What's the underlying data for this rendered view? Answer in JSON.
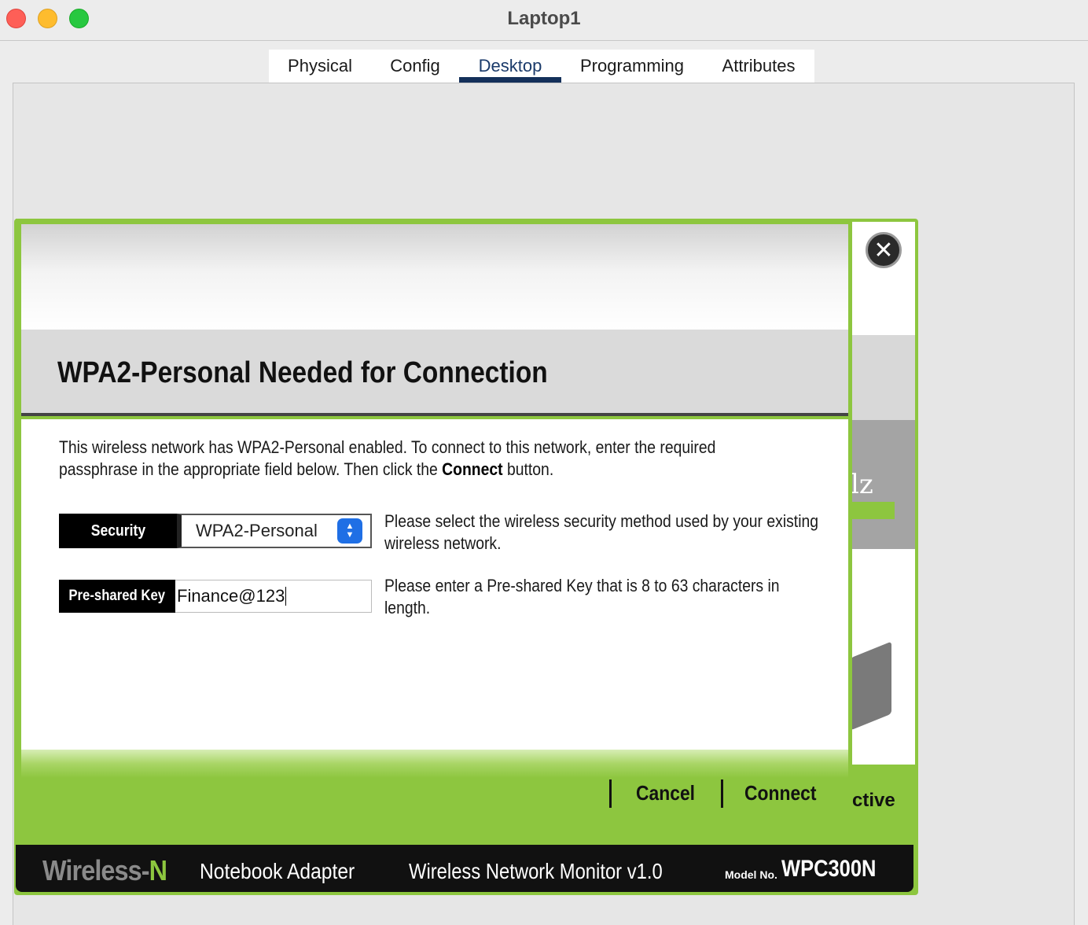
{
  "window": {
    "title": "Laptop1"
  },
  "tabs": [
    {
      "label": "Physical"
    },
    {
      "label": "Config"
    },
    {
      "label": "Desktop"
    },
    {
      "label": "Programming"
    },
    {
      "label": "Attributes"
    }
  ],
  "active_tab": "Desktop",
  "monitor": {
    "band_text": "lz",
    "status_text": "ctive",
    "brand_prefix": "Wireless-",
    "brand_suffix": "N",
    "adapter": "Notebook Adapter",
    "app_name": "Wireless Network Monitor  v1.0",
    "model_label": "Model No.",
    "model_number": "WPC300N"
  },
  "dialog": {
    "title": "WPA2-Personal Needed for Connection",
    "description_part1": "This wireless network has WPA2-Personal enabled. To connect to this network, enter the required passphrase in the appropriate field below. Then click the ",
    "description_bold": "Connect",
    "description_part2": " button.",
    "security_label": "Security",
    "security_value": "WPA2-Personal",
    "security_hint": "Please select the wireless security method used by your existing wireless network.",
    "psk_label": "Pre-shared Key",
    "psk_value": "Finance@123",
    "psk_hint": "Please enter a Pre-shared Key that is 8 to 63 characters in length.",
    "cancel_label": "Cancel",
    "connect_label": "Connect"
  },
  "colors": {
    "accent_green": "#8dc63f",
    "tab_active": "#14305a",
    "select_blue": "#1f6fe5"
  }
}
